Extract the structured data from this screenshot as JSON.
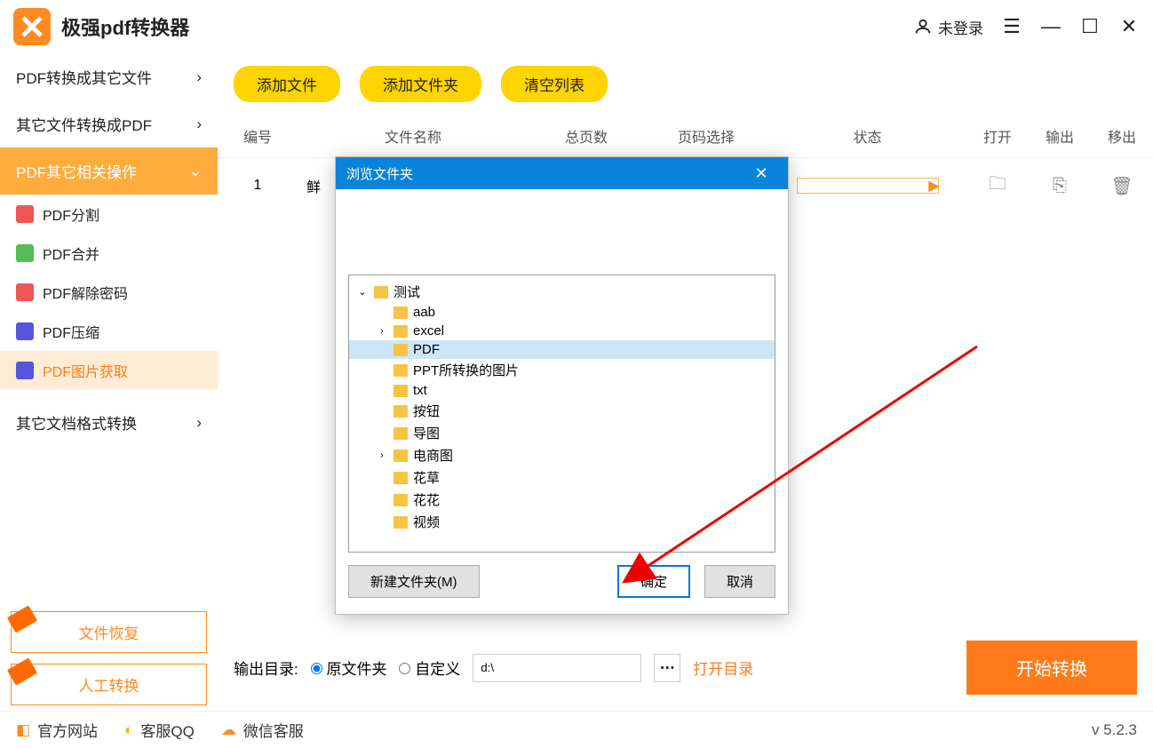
{
  "header": {
    "app_title": "极强pdf转换器",
    "login_label": "未登录"
  },
  "sidebar": {
    "cats": [
      {
        "label": "PDF转换成其它文件",
        "chevron": "›"
      },
      {
        "label": "其它文件转换成PDF",
        "chevron": "›"
      },
      {
        "label": "PDF其它相关操作",
        "chevron": "⌄",
        "active": true
      },
      {
        "label": "其它文档格式转换",
        "chevron": "›"
      }
    ],
    "items": [
      {
        "label": "PDF分割",
        "color": "#e55"
      },
      {
        "label": "PDF合并",
        "color": "#5b5"
      },
      {
        "label": "PDF解除密码",
        "color": "#e55"
      },
      {
        "label": "PDF压缩",
        "color": "#55d"
      },
      {
        "label": "PDF图片获取",
        "color": "#55d",
        "selected": true
      }
    ],
    "hot": [
      "文件恢复",
      "人工转换"
    ]
  },
  "toolbar": {
    "add_file": "添加文件",
    "add_folder": "添加文件夹",
    "clear_list": "清空列表"
  },
  "table": {
    "headers": {
      "no": "编号",
      "name": "文件名称",
      "pages": "总页数",
      "range": "页码选择",
      "status": "状态",
      "open": "打开",
      "out": "输出",
      "del": "移出"
    },
    "row": {
      "no": "1",
      "name": "鲜"
    }
  },
  "output": {
    "label": "输出目录:",
    "opt_original": "原文件夹",
    "opt_custom": "自定义",
    "path": "d:\\",
    "open_dir": "打开目录",
    "start": "开始转换"
  },
  "footer": {
    "site": "官方网站",
    "qq": "客服QQ",
    "wechat": "微信客服",
    "version": "v 5.2.3"
  },
  "dialog": {
    "title": "浏览文件夹",
    "tree": [
      {
        "label": "测试",
        "indent": 0,
        "toggle": "⌄"
      },
      {
        "label": "aab",
        "indent": 1
      },
      {
        "label": "excel",
        "indent": 1,
        "toggle": "›"
      },
      {
        "label": "PDF",
        "indent": 1,
        "selected": true
      },
      {
        "label": "PPT所转换的图片",
        "indent": 1
      },
      {
        "label": "txt",
        "indent": 1
      },
      {
        "label": "按钮",
        "indent": 1
      },
      {
        "label": "导图",
        "indent": 1
      },
      {
        "label": "电商图",
        "indent": 1,
        "toggle": "›"
      },
      {
        "label": "花草",
        "indent": 1
      },
      {
        "label": "花花",
        "indent": 1
      },
      {
        "label": "视频",
        "indent": 1
      }
    ],
    "new_folder": "新建文件夹(M)",
    "ok": "确定",
    "cancel": "取消"
  }
}
